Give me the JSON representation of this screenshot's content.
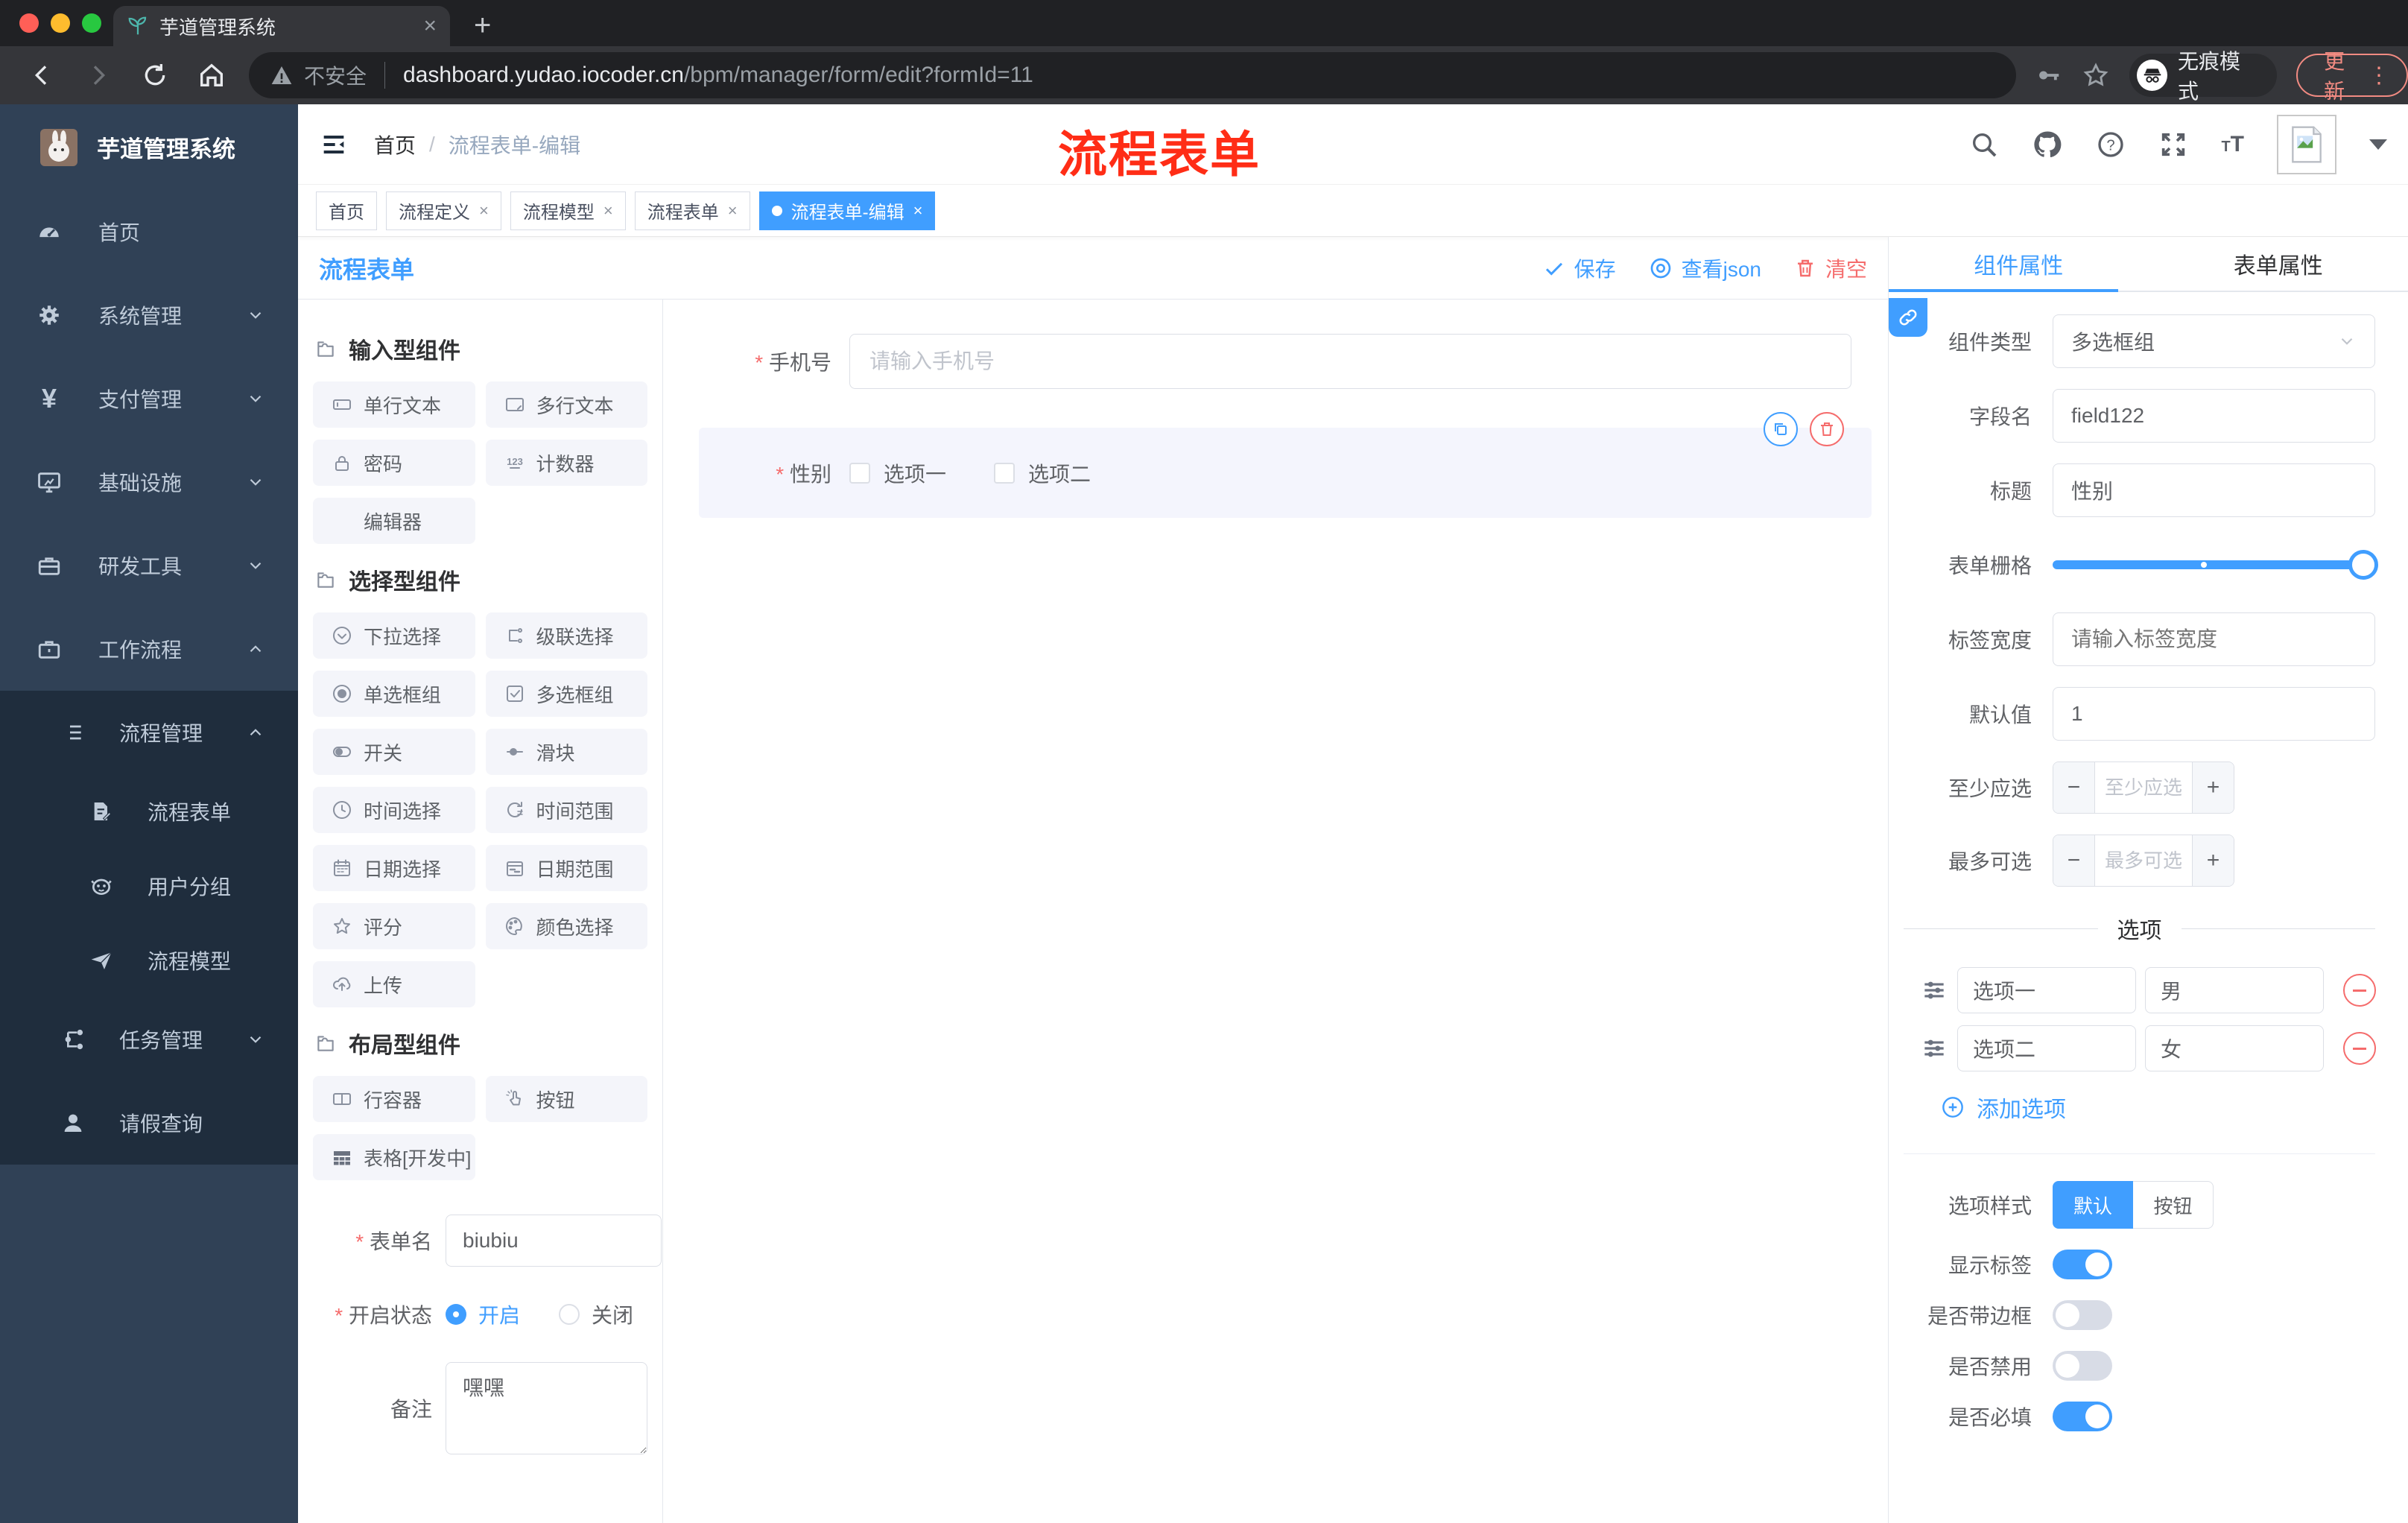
{
  "browser": {
    "tab_title": "芋道管理系统",
    "security_label": "不安全",
    "url_domain": "dashboard.yudao.iocoder.cn",
    "url_path": "/bpm/manager/form/edit?formId=11",
    "incognito_label": "无痕模式",
    "update_label": "更新"
  },
  "sidebar": {
    "brand": "芋道管理系统",
    "items": [
      {
        "label": "首页",
        "icon": "dashboard-icon"
      },
      {
        "label": "系统管理",
        "icon": "gear-icon"
      },
      {
        "label": "支付管理",
        "icon": "yen-icon"
      },
      {
        "label": "基础设施",
        "icon": "monitor-icon"
      },
      {
        "label": "研发工具",
        "icon": "toolbox-icon"
      },
      {
        "label": "工作流程",
        "icon": "briefcase-icon"
      }
    ],
    "submenu": {
      "group": {
        "label": "流程管理",
        "icon": "list-icon"
      },
      "children": [
        {
          "label": "流程表单",
          "icon": "document-edit-icon"
        },
        {
          "label": "用户分组",
          "icon": "robot-icon"
        },
        {
          "label": "流程模型",
          "icon": "paper-plane-icon"
        }
      ],
      "siblings": [
        {
          "label": "任务管理",
          "icon": "tree-icon"
        },
        {
          "label": "请假查询",
          "icon": "person-icon"
        }
      ]
    }
  },
  "header": {
    "breadcrumb": [
      "首页",
      "流程表单-编辑"
    ],
    "annotation": "流程表单"
  },
  "tags": [
    {
      "label": "首页"
    },
    {
      "label": "流程定义"
    },
    {
      "label": "流程模型"
    },
    {
      "label": "流程表单"
    },
    {
      "label": "流程表单-编辑"
    }
  ],
  "designer": {
    "title": "流程表单",
    "save_label": "保存",
    "view_json_label": "查看json",
    "clear_label": "清空",
    "palette": {
      "sections": [
        {
          "title": "输入型组件",
          "items": [
            {
              "label": "单行文本"
            },
            {
              "label": "多行文本"
            },
            {
              "label": "密码"
            },
            {
              "label": "计数器"
            },
            {
              "label": "编辑器"
            }
          ]
        },
        {
          "title": "选择型组件",
          "items": [
            {
              "label": "下拉选择"
            },
            {
              "label": "级联选择"
            },
            {
              "label": "单选框组"
            },
            {
              "label": "多选框组"
            },
            {
              "label": "开关"
            },
            {
              "label": "滑块"
            },
            {
              "label": "时间选择"
            },
            {
              "label": "时间范围"
            },
            {
              "label": "日期选择"
            },
            {
              "label": "日期范围"
            },
            {
              "label": "评分"
            },
            {
              "label": "颜色选择"
            },
            {
              "label": "上传"
            }
          ]
        },
        {
          "title": "布局型组件",
          "items": [
            {
              "label": "行容器"
            },
            {
              "label": "按钮"
            },
            {
              "label": "表格[开发中]"
            }
          ]
        }
      ]
    },
    "meta": {
      "name_label": "表单名",
      "name_value": "biubiu",
      "status_label": "开启状态",
      "status_on": "开启",
      "status_off": "关闭",
      "remark_label": "备注",
      "remark_value": "嘿嘿"
    },
    "canvas": {
      "phone_label": "手机号",
      "phone_placeholder": "请输入手机号",
      "gender_label": "性别",
      "gender_options": [
        {
          "label": "选项一"
        },
        {
          "label": "选项二"
        }
      ]
    }
  },
  "properties": {
    "tab_component": "组件属性",
    "tab_form": "表单属性",
    "component_type_label": "组件类型",
    "component_type_value": "多选框组",
    "field_name_label": "字段名",
    "field_name_value": "field122",
    "title_label": "标题",
    "title_value": "性别",
    "grid_label": "表单栅格",
    "label_width_label": "标签宽度",
    "label_width_placeholder": "请输入标签宽度",
    "default_label": "默认值",
    "default_value": "1",
    "min_label": "至少应选",
    "min_placeholder": "至少应选",
    "max_label": "最多可选",
    "max_placeholder": "最多可选",
    "options_title": "选项",
    "options": [
      {
        "label": "选项一",
        "value": "男"
      },
      {
        "label": "选项二",
        "value": "女"
      }
    ],
    "add_option_label": "添加选项",
    "option_style_label": "选项样式",
    "option_style_default": "默认",
    "option_style_button": "按钮",
    "switch_show_label": "显示标签",
    "switch_border_label": "是否带边框",
    "switch_disabled_label": "是否禁用",
    "switch_required_label": "是否必填"
  },
  "colors": {
    "accent": "#409eff",
    "danger": "#f56c6c",
    "annotation_red": "#ff2d16",
    "sidebar_bg": "#304156",
    "submenu_bg": "#1f2d3d",
    "incognito_bg": "#35363a"
  }
}
